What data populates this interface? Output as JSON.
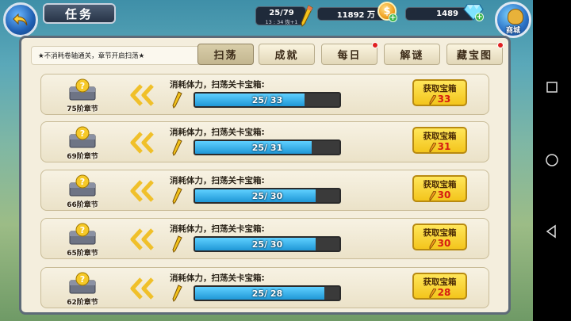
{
  "header": {
    "title": "任务",
    "stamina": "25/79",
    "stamina_timer": "13 : 34 恢+1",
    "gold": "11892 万",
    "gold_symbol": "$",
    "gems": "1489",
    "shop_label": "商城"
  },
  "notice": "★不消耗卷轴通关，章节开启扫荡★",
  "tabs": [
    {
      "label": "扫荡",
      "active": true,
      "badge": false
    },
    {
      "label": "成就",
      "active": false,
      "badge": false
    },
    {
      "label": "每日",
      "active": false,
      "badge": true
    },
    {
      "label": "解谜",
      "active": false,
      "badge": false
    },
    {
      "label": "藏宝图",
      "active": false,
      "badge": true
    }
  ],
  "rows": [
    {
      "chapter": "75阶章节",
      "desc": "消耗体力，扫荡关卡宝箱:",
      "progress_text": "25/ 33",
      "progress": 0.7576,
      "button": "获取宝箱",
      "cost": "33"
    },
    {
      "chapter": "69阶章节",
      "desc": "消耗体力，扫荡关卡宝箱:",
      "progress_text": "25/ 31",
      "progress": 0.8065,
      "button": "获取宝箱",
      "cost": "31"
    },
    {
      "chapter": "66阶章节",
      "desc": "消耗体力，扫荡关卡宝箱:",
      "progress_text": "25/ 30",
      "progress": 0.8333,
      "button": "获取宝箱",
      "cost": "30"
    },
    {
      "chapter": "65阶章节",
      "desc": "消耗体力，扫荡关卡宝箱:",
      "progress_text": "25/ 30",
      "progress": 0.8333,
      "button": "获取宝箱",
      "cost": "30"
    },
    {
      "chapter": "62阶章节",
      "desc": "消耗体力，扫荡关卡宝箱:",
      "progress_text": "25/ 28",
      "progress": 0.8929,
      "button": "获取宝箱",
      "cost": "28"
    }
  ],
  "colors": {
    "accent": "#f3c51c",
    "progress": "#1f97d6",
    "cost": "#d61d12"
  }
}
